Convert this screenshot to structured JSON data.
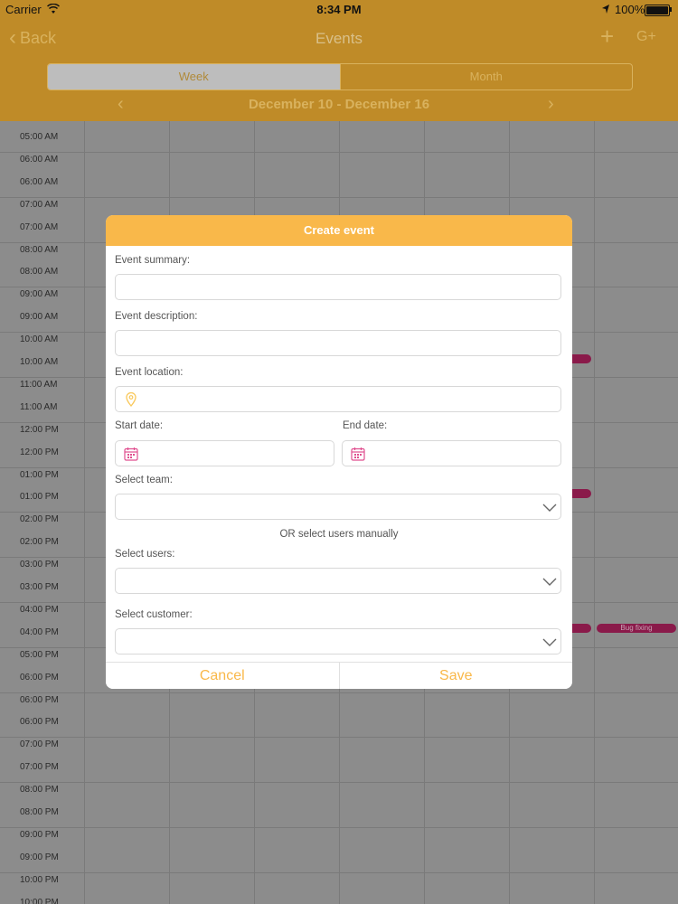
{
  "status_bar": {
    "carrier": "Carrier",
    "time": "8:34 PM",
    "battery": "100%"
  },
  "nav": {
    "back_label": "Back",
    "title": "Events",
    "plus_label": "+",
    "google_label": "G+"
  },
  "view_switch": {
    "week_label": "Week",
    "month_label": "Month",
    "selected": "Week"
  },
  "week_nav": {
    "range": "December 10 - December 16",
    "prev": "‹",
    "next": "›"
  },
  "calendar": {
    "time_labels": [
      "05:00 AM",
      "06:00 AM",
      "06:00 AM",
      "07:00 AM",
      "07:00 AM",
      "08:00 AM",
      "08:00 AM",
      "09:00 AM",
      "09:00 AM",
      "10:00 AM",
      "10:00 AM",
      "11:00 AM",
      "11:00 AM",
      "12:00 PM",
      "12:00 PM",
      "01:00 PM",
      "01:00 PM",
      "02:00 PM",
      "02:00 PM",
      "03:00 PM",
      "03:00 PM",
      "04:00 PM",
      "04:00 PM",
      "05:00 PM",
      "06:00 PM",
      "06:00 PM",
      "06:00 PM",
      "07:00 PM",
      "07:00 PM",
      "08:00 PM",
      "08:00 PM",
      "09:00 PM",
      "09:00 PM",
      "10:00 PM",
      "10:00 PM"
    ],
    "event_label": "Bug fixing"
  },
  "modal": {
    "title": "Create event",
    "summary_label": "Event summary:",
    "description_label": "Event description:",
    "location_label": "Event location:",
    "start_label": "Start date:",
    "end_label": "End date:",
    "team_label": "Select team:",
    "or_text": "OR select users manually",
    "users_label": "Select users:",
    "customer_label": "Select customer:",
    "cancel_label": "Cancel",
    "save_label": "Save"
  },
  "colors": {
    "header": "#bf8b28",
    "accent": "#f9b84a",
    "calendar_icon": "#e04f8f",
    "event_bar": "#8a1a4a"
  }
}
